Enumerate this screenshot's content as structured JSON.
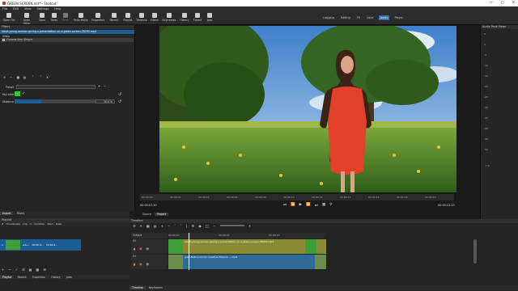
{
  "window": {
    "title": "GREEN SCREEN.mlt* - Shotcut",
    "minimize_icon": "minimize-icon",
    "maximize_icon": "maximize-icon",
    "close_icon": "close-icon"
  },
  "menu": [
    "File",
    "Edit",
    "View",
    "Settings",
    "Help"
  ],
  "toolbar": {
    "buttons": [
      {
        "label": "Open File",
        "icon": "folder-open-icon"
      },
      {
        "label": "Open Other",
        "icon": "open-other-icon"
      },
      {
        "label": "Save",
        "icon": "save-icon"
      },
      {
        "label": "Undo",
        "icon": "undo-icon"
      },
      {
        "label": "Redo",
        "icon": "redo-icon"
      },
      {
        "label": "Peak Meter",
        "icon": "peak-meter-icon"
      },
      {
        "label": "Properties",
        "icon": "properties-icon"
      },
      {
        "label": "Recent",
        "icon": "recent-icon"
      },
      {
        "label": "Playlist",
        "icon": "playlist-icon"
      },
      {
        "label": "Timeline",
        "icon": "timeline-icon"
      },
      {
        "label": "Filters",
        "icon": "filters-icon"
      },
      {
        "label": "Keyframes",
        "icon": "keyframes-icon"
      },
      {
        "label": "History",
        "icon": "history-icon"
      },
      {
        "label": "Export",
        "icon": "export-icon"
      },
      {
        "label": "Jobs",
        "icon": "jobs-icon"
      }
    ],
    "layouts": [
      "Logging",
      "Editing",
      "FX",
      "Color",
      "Audio",
      "Player"
    ],
    "active_layout": "Audio"
  },
  "filters": {
    "panel_title": "Filters",
    "clip_name": "adult-young-woman-giving-a-presentation-on-a-green-screen-28292.mp4",
    "section_video": "Video",
    "filter_name": "Chroma Key: Simple",
    "preset_label": "Preset",
    "key_color_label": "Key color",
    "key_color": "#2ecc2e",
    "distance_label": "Distance",
    "distance_value": "30.0",
    "distance_unit": "%",
    "distance_fraction": 0.3
  },
  "viewer": {
    "timecode_current": "00:00:07:15",
    "timecode_total": "00:00:22:13",
    "ruler_ticks": [
      "00:00:00",
      "00:00:02",
      "00:00:04",
      "00:00:06",
      "00:00:08",
      "00:00:10",
      "00:00:12",
      "00:00:14",
      "00:00:16",
      "00:00:18",
      "00:00:20"
    ],
    "tabs": [
      "Source",
      "Project"
    ],
    "active_tab": "Project",
    "sky_color": "#4d8fd6",
    "grass_color": "#4f8a2a"
  },
  "audio_meter": {
    "title": "Audio Peak Meter",
    "scale": [
      "3",
      "0",
      "-5",
      "-10",
      "-15",
      "-20",
      "-25",
      "-30",
      "-35",
      "-40",
      "-45",
      "-50"
    ],
    "channels": "L R"
  },
  "playlist": {
    "tabs": [
      "Export",
      "Filters"
    ],
    "title": "Playlist",
    "columns": [
      "#",
      "Thumbnails",
      "Clip",
      "In",
      "Duration",
      "Start",
      "Date"
    ],
    "row": {
      "index": "1",
      "clip": "adu...",
      "in": "00:00:0...",
      "duration": "00:00:2...",
      "start": "00:00:0...",
      "date": "20..."
    },
    "bottom_tabs": [
      "Playlist",
      "Recent",
      "Properties",
      "History",
      "Jobs"
    ]
  },
  "timeline": {
    "title": "Timeline",
    "tracks": [
      {
        "name": "Output"
      },
      {
        "name": "V2"
      },
      {
        "name": "V1"
      }
    ],
    "ruler": [
      "00:00:00",
      "00:00:05",
      "00:00:10"
    ],
    "clip_v2": "adult-young-woman-giving-a-presentation-on-a-green-screen-28292.mp4",
    "clip_v1": "gran-field-summer-meadow-flowers-...-mp4",
    "bottom_tabs": [
      "Timeline",
      "Keyframes"
    ]
  }
}
